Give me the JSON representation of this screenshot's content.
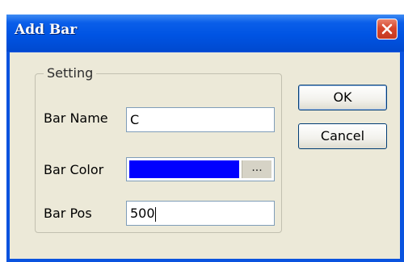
{
  "window": {
    "title": "Add Bar"
  },
  "group": {
    "label": "Setting"
  },
  "fields": {
    "bar_name_label": "Bar Name",
    "bar_name_value": "C",
    "bar_color_label": "Bar Color",
    "bar_color_value": "#0000ff",
    "bar_color_button": "...",
    "bar_pos_label": "Bar Pos",
    "bar_pos_value": "500"
  },
  "buttons": {
    "ok": "OK",
    "cancel": "Cancel"
  },
  "icons": {
    "close": "close-icon"
  },
  "colors": {
    "titlebar": "#0054e3",
    "dialog_bg": "#ece9d8",
    "close_button": "#d6462c"
  }
}
